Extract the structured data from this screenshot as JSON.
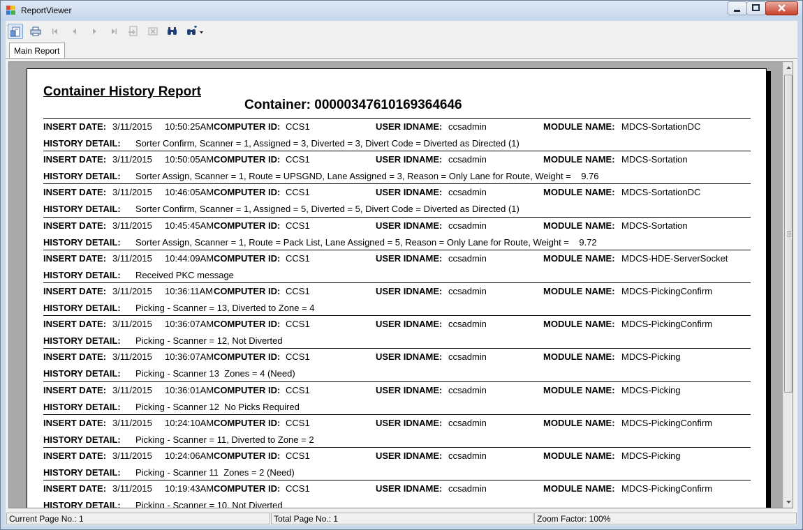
{
  "window": {
    "title": "ReportViewer"
  },
  "toolbar": {
    "buttons": [
      {
        "icon": "document-map-icon"
      },
      {
        "icon": "print-icon"
      },
      {
        "icon": "first-page-icon"
      },
      {
        "icon": "previous-page-icon"
      },
      {
        "icon": "next-page-icon"
      },
      {
        "icon": "last-page-icon"
      },
      {
        "icon": "export-icon"
      },
      {
        "icon": "close-report-icon"
      },
      {
        "icon": "find-icon"
      },
      {
        "icon": "zoom-icon"
      }
    ]
  },
  "tabs": [
    {
      "label": "Main Report"
    }
  ],
  "report": {
    "title": "Container History Report",
    "container": "Container: 00000347610169364646",
    "labels": {
      "insert_date": "INSERT DATE:",
      "computer_id": "COMPUTER ID:",
      "user_idname": "USER IDNAME:",
      "module_name": "MODULE NAME:",
      "history_detail": "HISTORY DETAIL:"
    },
    "records": [
      {
        "date": "3/11/2015",
        "time": "10:50:25AM",
        "computer": "CCS1",
        "user": "ccsadmin",
        "module": "MDCS-SortationDC",
        "detail": "Sorter Confirm, Scanner = 1, Assigned = 3, Diverted = 3, Divert Code = Diverted as Directed (1)"
      },
      {
        "date": "3/11/2015",
        "time": "10:50:05AM",
        "computer": "CCS1",
        "user": "ccsadmin",
        "module": "MDCS-Sortation",
        "detail": "Sorter Assign, Scanner = 1, Route = UPSGND, Lane Assigned = 3, Reason = Only Lane for Route, Weight =    9.76"
      },
      {
        "date": "3/11/2015",
        "time": "10:46:05AM",
        "computer": "CCS1",
        "user": "ccsadmin",
        "module": "MDCS-SortationDC",
        "detail": "Sorter Confirm, Scanner = 1, Assigned = 5, Diverted = 5, Divert Code = Diverted as Directed (1)"
      },
      {
        "date": "3/11/2015",
        "time": "10:45:45AM",
        "computer": "CCS1",
        "user": "ccsadmin",
        "module": "MDCS-Sortation",
        "detail": "Sorter Assign, Scanner = 1, Route = Pack List, Lane Assigned = 5, Reason = Only Lane for Route, Weight =    9.72"
      },
      {
        "date": "3/11/2015",
        "time": "10:44:09AM",
        "computer": "CCS1",
        "user": "ccsadmin",
        "module": "MDCS-HDE-ServerSocket",
        "detail": "Received PKC message"
      },
      {
        "date": "3/11/2015",
        "time": "10:36:11AM",
        "computer": "CCS1",
        "user": "ccsadmin",
        "module": "MDCS-PickingConfirm",
        "detail": "Picking - Scanner = 13, Diverted to Zone = 4"
      },
      {
        "date": "3/11/2015",
        "time": "10:36:07AM",
        "computer": "CCS1",
        "user": "ccsadmin",
        "module": "MDCS-PickingConfirm",
        "detail": "Picking - Scanner = 12, Not Diverted"
      },
      {
        "date": "3/11/2015",
        "time": "10:36:07AM",
        "computer": "CCS1",
        "user": "ccsadmin",
        "module": "MDCS-Picking",
        "detail": "Picking - Scanner 13  Zones = 4 (Need)"
      },
      {
        "date": "3/11/2015",
        "time": "10:36:01AM",
        "computer": "CCS1",
        "user": "ccsadmin",
        "module": "MDCS-Picking",
        "detail": "Picking - Scanner 12  No Picks Required"
      },
      {
        "date": "3/11/2015",
        "time": "10:24:10AM",
        "computer": "CCS1",
        "user": "ccsadmin",
        "module": "MDCS-PickingConfirm",
        "detail": "Picking - Scanner = 11, Diverted to Zone = 2"
      },
      {
        "date": "3/11/2015",
        "time": "10:24:06AM",
        "computer": "CCS1",
        "user": "ccsadmin",
        "module": "MDCS-Picking",
        "detail": "Picking - Scanner 11  Zones = 2 (Need)"
      },
      {
        "date": "3/11/2015",
        "time": "10:19:43AM",
        "computer": "CCS1",
        "user": "ccsadmin",
        "module": "MDCS-PickingConfirm",
        "detail": "Picking - Scanner = 10, Not Diverted"
      }
    ]
  },
  "status": {
    "current_page": "Current Page No.: 1",
    "total_page": "Total Page No.: 1",
    "zoom": "Zoom Factor: 100%"
  }
}
